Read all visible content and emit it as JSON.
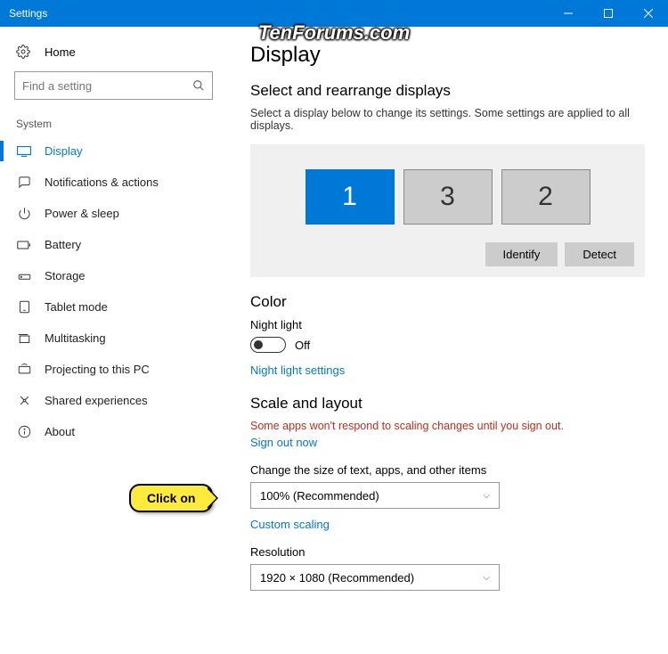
{
  "window": {
    "title": "Settings"
  },
  "watermark": "TenForums.com",
  "sidebar": {
    "home": "Home",
    "search_placeholder": "Find a setting",
    "section": "System",
    "items": [
      {
        "label": "Display",
        "active": true
      },
      {
        "label": "Notifications & actions"
      },
      {
        "label": "Power & sleep"
      },
      {
        "label": "Battery"
      },
      {
        "label": "Storage"
      },
      {
        "label": "Tablet mode"
      },
      {
        "label": "Multitasking"
      },
      {
        "label": "Projecting to this PC"
      },
      {
        "label": "Shared experiences"
      },
      {
        "label": "About"
      }
    ]
  },
  "main": {
    "title": "Display",
    "arrange": {
      "heading": "Select and rearrange displays",
      "desc": "Select a display below to change its settings. Some settings are applied to all displays.",
      "monitors": [
        "1",
        "3",
        "2"
      ],
      "identify": "Identify",
      "detect": "Detect"
    },
    "color": {
      "heading": "Color",
      "night_light_label": "Night light",
      "night_light_state": "Off",
      "settings_link": "Night light settings"
    },
    "scale": {
      "heading": "Scale and layout",
      "warning": "Some apps won't respond to scaling changes until you sign out.",
      "signout": "Sign out now",
      "size_label": "Change the size of text, apps, and other items",
      "size_value": "100% (Recommended)",
      "custom_link": "Custom scaling",
      "resolution_label": "Resolution",
      "resolution_value": "1920 × 1080 (Recommended)"
    }
  },
  "callout": "Click on"
}
